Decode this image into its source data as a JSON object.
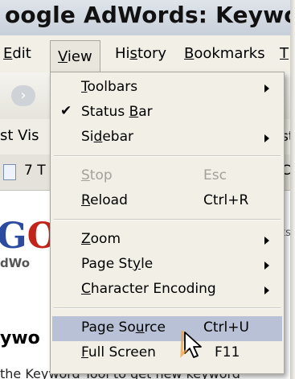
{
  "window": {
    "title": "oogle AdWords: Keyword"
  },
  "menubar": {
    "items": [
      {
        "pre": "",
        "key": "E",
        "post": "dit"
      },
      {
        "pre": "",
        "key": "V",
        "post": "iew"
      },
      {
        "pre": "Hi",
        "key": "s",
        "post": "tory"
      },
      {
        "pre": "",
        "key": "B",
        "post": "ookmarks"
      },
      {
        "pre": "",
        "key": "T",
        "post": ""
      }
    ]
  },
  "background": {
    "bookmarks_text": "st Vis",
    "tab_text": "7 T",
    "logo_g": "G",
    "logo_o": "O",
    "logo_sub": "dWo",
    "heading": "ywo",
    "bottom_text": "the Keyword Tool to get new keyword",
    "right_st1": "st",
    "right_cl": "Cl",
    "right_ts": "ts"
  },
  "view_menu": {
    "items": [
      {
        "pre": "",
        "key": "T",
        "post": "oolbars",
        "shortcut": ""
      },
      {
        "pre": "Status ",
        "key": "B",
        "post": "ar",
        "shortcut": ""
      },
      {
        "pre": "Si",
        "key": "d",
        "post": "ebar",
        "shortcut": ""
      },
      {
        "pre": "",
        "key": "S",
        "post": "top",
        "shortcut": "Esc"
      },
      {
        "pre": "",
        "key": "R",
        "post": "eload",
        "shortcut": "Ctrl+R"
      },
      {
        "pre": "",
        "key": "Z",
        "post": "oom",
        "shortcut": ""
      },
      {
        "pre": "Page St",
        "key": "y",
        "post": "le",
        "shortcut": ""
      },
      {
        "pre": "",
        "key": "C",
        "post": "haracter Encoding",
        "shortcut": ""
      },
      {
        "pre": "Page So",
        "key": "u",
        "post": "rce",
        "shortcut": "Ctrl+U"
      },
      {
        "pre": "",
        "key": "F",
        "post": "ull Screen",
        "shortcut": "F11"
      }
    ]
  },
  "icons": {
    "forward": "forward-arrow-icon",
    "checkmark": "checkmark-icon",
    "submenu": "submenu-arrow-icon",
    "cursor": "mouse-pointer-icon"
  }
}
